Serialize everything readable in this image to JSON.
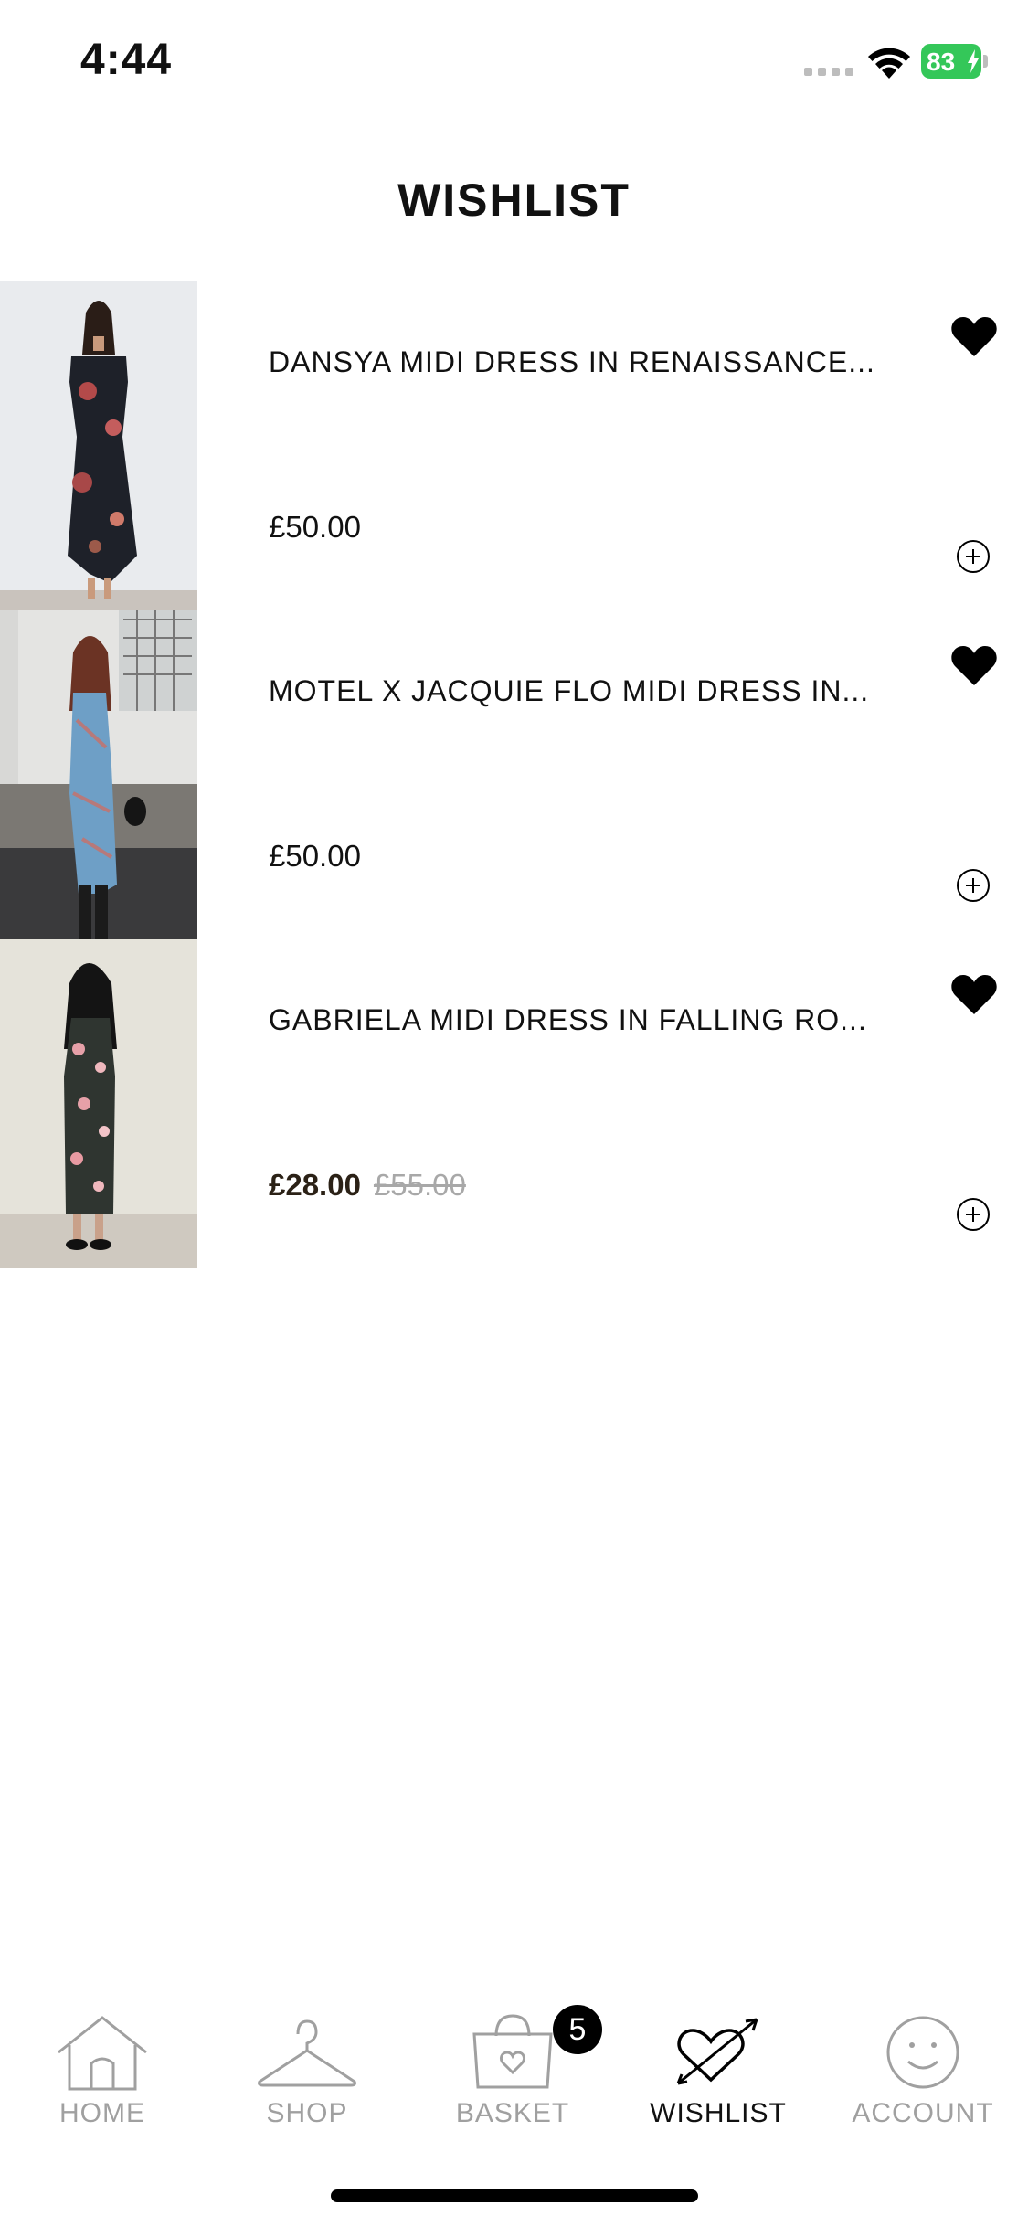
{
  "status_bar": {
    "time": "4:44",
    "battery": "83"
  },
  "header": {
    "title": "WISHLIST"
  },
  "items": [
    {
      "name": "DANSYA MIDI DRESS IN RENAISSANCE...",
      "price": "£50.00",
      "sale_price": "",
      "original_price": ""
    },
    {
      "name": "MOTEL X JACQUIE FLO MIDI DRESS IN...",
      "price": "£50.00",
      "sale_price": "",
      "original_price": ""
    },
    {
      "name": "GABRIELA MIDI DRESS IN FALLING RO...",
      "price": "",
      "sale_price": "£28.00",
      "original_price": "£55.00"
    }
  ],
  "tab_bar": {
    "tabs": [
      {
        "label": "HOME",
        "icon": "house-icon",
        "active": false
      },
      {
        "label": "SHOP",
        "icon": "hanger-icon",
        "active": false
      },
      {
        "label": "BASKET",
        "icon": "basket-heart-icon",
        "active": false
      },
      {
        "label": "WISHLIST",
        "icon": "heart-arrow-icon",
        "active": true
      },
      {
        "label": "ACCOUNT",
        "icon": "smiley-icon",
        "active": false
      }
    ],
    "basket_count": "5"
  },
  "colors": {
    "accent": "#000000",
    "inactive_tab": "#a0a0a0",
    "battery": "#34c759",
    "sale_price": "#2b2116",
    "original_price": "#a8a8a8"
  }
}
